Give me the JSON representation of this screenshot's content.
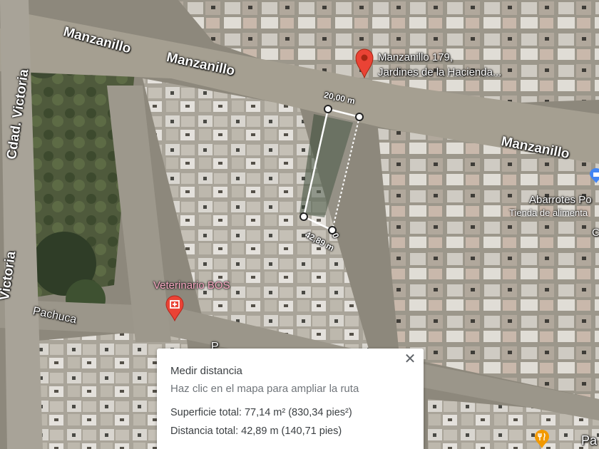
{
  "map": {
    "streets": {
      "manzanillo_1": "Manzanillo",
      "manzanillo_2": "Manzanillo",
      "manzanillo_3": "Manzanillo",
      "cdad_victoria_1": "Cdad. Victoria",
      "cdad_victoria_2": "Victoria",
      "pachuca": "Pachuca",
      "partial_bottom": "Pa",
      "partial_bottom_mid": "P"
    },
    "place_pin": {
      "line1": "Manzanillo 179,",
      "line2": "Jardines de la Hacienda...",
      "icon": "red-location-pin",
      "color": "#ea4335"
    },
    "pois": {
      "veterinario": {
        "label": "Veterinario BOS",
        "icon": "vet-hospital-icon",
        "color": "#ea4335"
      },
      "abarrotes": {
        "label": "Abarrotes Po",
        "subtitle": "Tienda de alimenta",
        "icon": "shopping-bag-icon",
        "color": "#4285f4"
      },
      "partial_c": {
        "label": "C"
      },
      "restaurant": {
        "icon": "fork-knife-icon",
        "color": "#f29900"
      }
    },
    "measure": {
      "top_edge": "20,00 m",
      "bottom_edge": "42,89 m",
      "vertex_label": "0"
    }
  },
  "panel": {
    "title": "Medir distancia",
    "hint": "Haz clic en el mapa para ampliar la ruta",
    "area": "Superficie total: 77,14 m² (830,34 pies²)",
    "distance": "Distancia total: 42,89 m (140,71 pies)",
    "close_icon": "close-icon"
  }
}
